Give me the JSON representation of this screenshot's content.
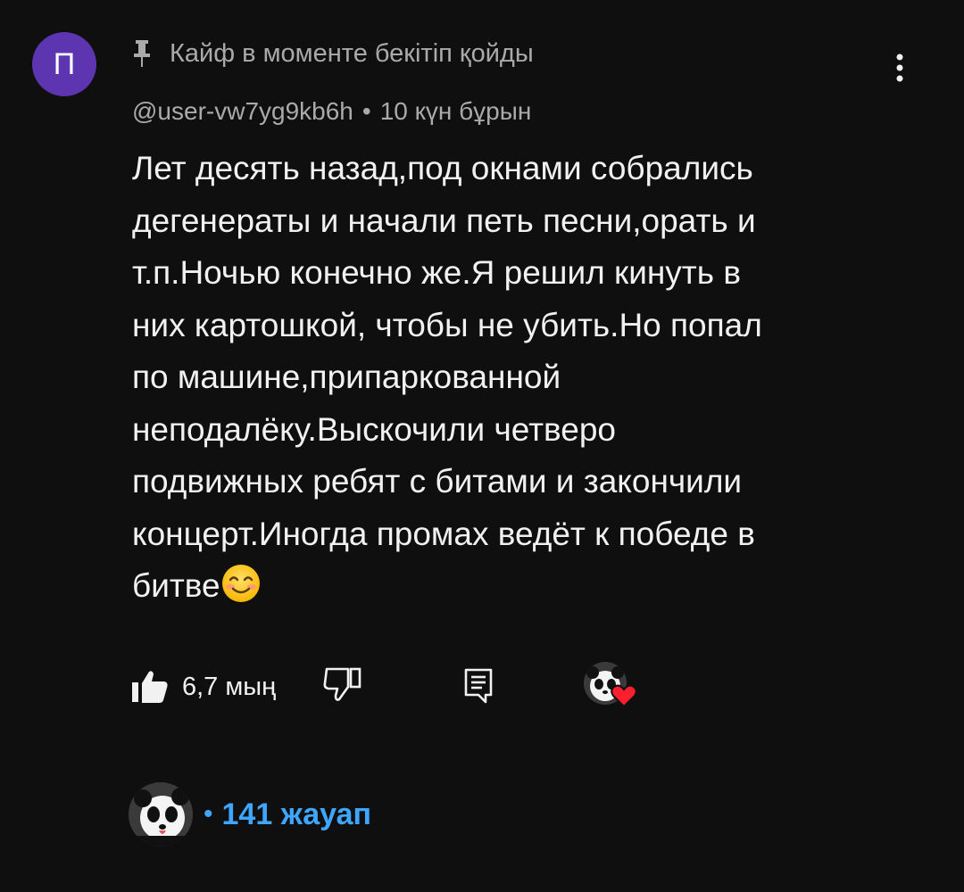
{
  "comment": {
    "avatar_letter": "П",
    "pinned_label": "Кайф в моменте бекітіп қойды",
    "author": "@user-vw7yg9kb6h",
    "separator": "•",
    "time_ago": "10 күн бұрын",
    "text": "Лет десять назад,под окнами собрались\nдегенераты и начали петь песни,орать и\nт.п.Ночью конечно же.Я решил кинуть в\nних картошкой, чтобы не убить.Но попал\nпо машине,припаркованной\nнеподалёку.Выскочили четверо\nподвижных ребят с битами и закончили\nконцерт.Иногда промах ведёт к победе в\nбитве",
    "emoji": "smiling-face-emoji",
    "like_count": "6,7 мың",
    "replies_label": "141 жауап",
    "replies_dot": "•"
  },
  "colors": {
    "background": "#0f0f0f",
    "text": "#f1f1f1",
    "secondary_text": "#aaaaaa",
    "avatar_bg": "#5e35b1",
    "link_blue": "#3ea6ff",
    "heart_red": "#ff1e2d"
  },
  "icons": {
    "pin": "pin-icon",
    "more": "more-vert-icon",
    "like": "thumbs-up-icon",
    "dislike": "thumbs-down-icon",
    "reply": "reply-icon",
    "heart": "heart-icon"
  }
}
